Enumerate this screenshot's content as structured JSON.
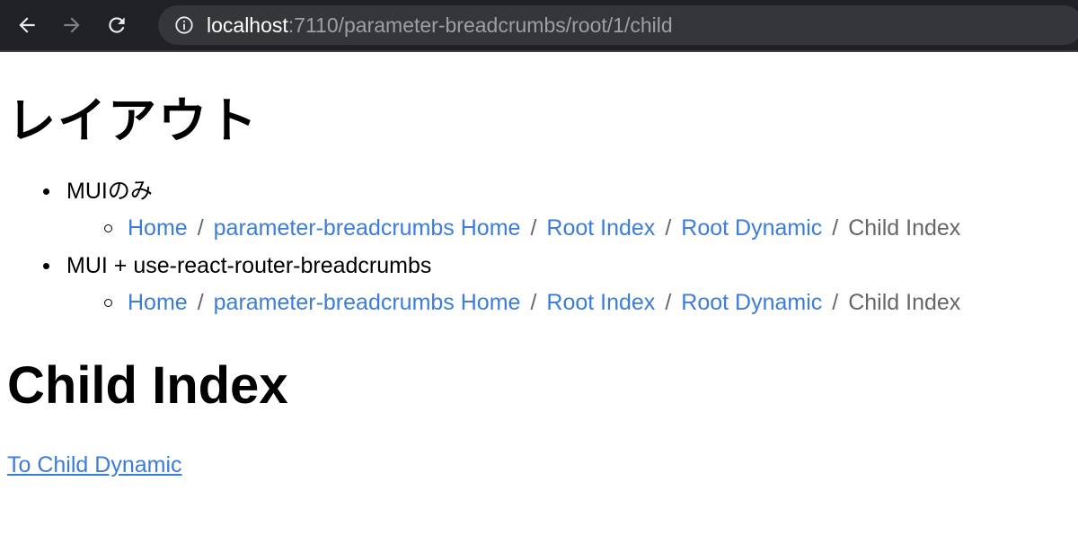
{
  "browser": {
    "url_host": "localhost",
    "url_rest": ":7110/parameter-breadcrumbs/root/1/child"
  },
  "layout_heading": "レイアウト",
  "sections": [
    {
      "label": "MUIのみ",
      "breadcrumbs": [
        "Home",
        "parameter-breadcrumbs Home",
        "Root Index",
        "Root Dynamic"
      ],
      "current": "Child Index"
    },
    {
      "label": "MUI + use-react-router-breadcrumbs",
      "breadcrumbs": [
        "Home",
        "parameter-breadcrumbs Home",
        "Root Index",
        "Root Dynamic"
      ],
      "current": "Child Index"
    }
  ],
  "separator": "/",
  "page_title": "Child Index",
  "child_link": "To Child Dynamic"
}
